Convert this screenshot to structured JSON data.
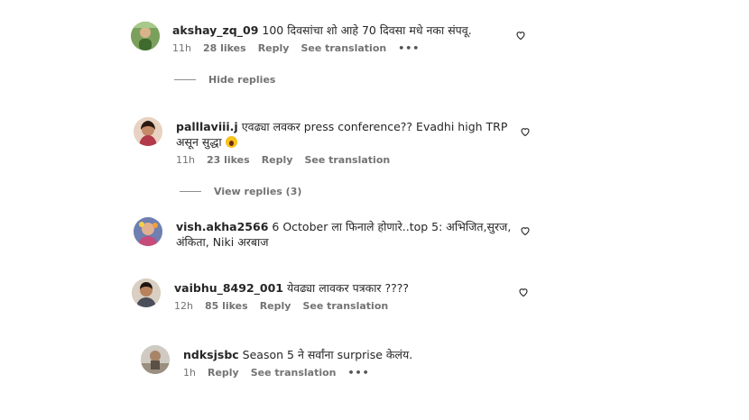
{
  "comments": [
    {
      "username": "akshay_zq_09",
      "text": "100 दिवसांचा शो आहे 70 दिवसा मधे नका संपवू.",
      "time": "11h",
      "likes": "28 likes",
      "reply": "Reply",
      "translation": "See translation",
      "more": "•••"
    },
    {
      "username": "palllaviii.j",
      "text": "एवढ्या लवकर press conference?? Evadhi high TRP",
      "text_line2": "असून सुद्धा",
      "emoji_icon": "astonished-face",
      "time": "11h",
      "likes": "23 likes",
      "reply": "Reply",
      "translation": "See translation"
    },
    {
      "username": "vish.akha2566",
      "text": "6 October ला फिनाले होणारे..top 5: अभिजित,सुरज,",
      "text_line2": "अंकिता, Niki अरबाज"
    },
    {
      "username": "vaibhu_8492_001",
      "text": "येवढ्या लावकर पत्रकार ????",
      "time": "12h",
      "likes": "85 likes",
      "reply": "Reply",
      "translation": "See translation"
    },
    {
      "username": "ndksjsbc",
      "text": "Season 5 ने सर्वांना surprise केलंय.",
      "time": "1h",
      "reply": "Reply",
      "translation": "See translation",
      "more": "•••"
    }
  ],
  "threads": {
    "hide_replies": "Hide replies",
    "view_replies": "View replies (3)"
  },
  "colors": {
    "username": "#262626",
    "meta": "#737373",
    "background": "#ffffff"
  }
}
